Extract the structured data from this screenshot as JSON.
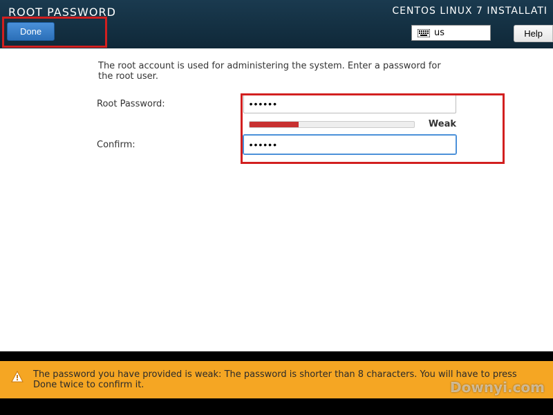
{
  "header": {
    "page_title": "ROOT PASSWORD",
    "installer_title": "CENTOS LINUX 7 INSTALLATI",
    "done_label": "Done",
    "help_label": "Help",
    "keyboard_layout": "us"
  },
  "form": {
    "description": "The root account is used for administering the system.  Enter a password for the root user.",
    "password_label": "Root Password:",
    "password_value": "••••••",
    "confirm_label": "Confirm:",
    "confirm_value": "••••••",
    "strength_label": "Weak",
    "strength_percent": 30
  },
  "warning": {
    "text": "The password you have provided is weak: The password is shorter than 8 characters. You will have to press Done twice to confirm it."
  },
  "watermark": {
    "main": "Downyi.com"
  }
}
